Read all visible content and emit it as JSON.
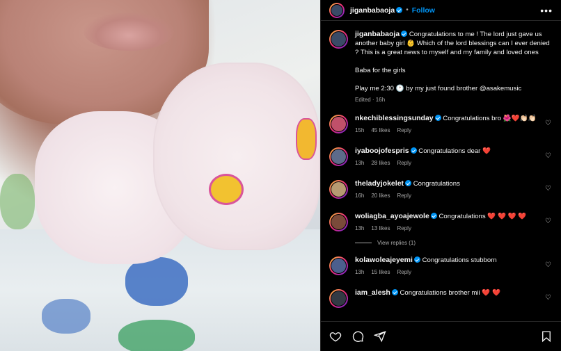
{
  "header": {
    "username": "jiganbabaoja",
    "separator": "•",
    "follow_label": "Follow",
    "more_label": "•••"
  },
  "caption": {
    "username": "jiganbabaoja",
    "paragraph1": "Congratulations to me ! The lord just gave us another baby girl 👶 Which of the lord blessings can I ever denied ? This is a great news to myself and my family and loved ones",
    "paragraph2": "Baba for the girls",
    "paragraph3": "Play me 2:30 🕐 by my just found brother @asakemusic",
    "meta": "Edited · 16h"
  },
  "comments": [
    {
      "username": "nkechiblessingsunday",
      "text": "Congratulations bro",
      "emoji": "🌺❤️👏🏻👏🏻",
      "time": "15h",
      "likes": "45 likes",
      "reply": "Reply",
      "avatar_color": "#c0506a"
    },
    {
      "username": "iyaboojofespris",
      "text": "Congratulations dear",
      "emoji": "❤️",
      "time": "13h",
      "likes": "28 likes",
      "reply": "Reply",
      "avatar_color": "#5d6b8a"
    },
    {
      "username": "theladyjokelet",
      "text": "Congratulations",
      "emoji": "",
      "time": "16h",
      "likes": "20 likes",
      "reply": "Reply",
      "avatar_color": "#b79a72"
    },
    {
      "username": "woliagba_ayoajewole",
      "text": "Congratulations",
      "emoji": "❤️ ❤️ ❤️ ❤️",
      "time": "13h",
      "likes": "13 likes",
      "reply": "Reply",
      "avatar_color": "#7a4a3a"
    },
    {
      "username": "kolawoleajeyemi",
      "text": "Congratulations stubborn",
      "emoji": "",
      "time": "13h",
      "likes": "15 likes",
      "reply": "Reply",
      "avatar_color": "#4c5f8d"
    },
    {
      "username": "iam_alesh",
      "text": "Congratulations brother mii",
      "emoji": "❤️ ❤️",
      "time": "",
      "likes": "",
      "reply": "",
      "avatar_color": "#333a44"
    }
  ],
  "view_replies": "View replies (1)",
  "actions": {
    "like_icon": "heart-outline-icon",
    "comment_icon": "comment-icon",
    "share_icon": "share-icon",
    "save_icon": "bookmark-icon"
  },
  "colors": {
    "background": "#000000",
    "link_blue": "#0095f6",
    "secondary_text": "#a8a8a8",
    "heart_red": "#ed4956"
  }
}
